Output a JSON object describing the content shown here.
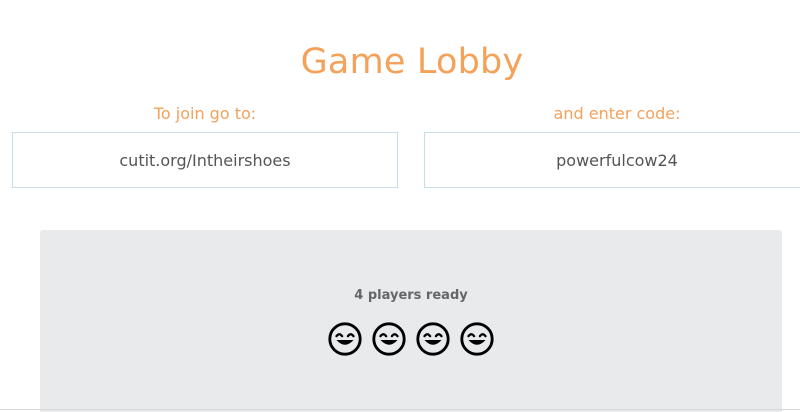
{
  "header": {
    "title": "Game Lobby"
  },
  "join": {
    "label": "To join go to:",
    "url": "cutit.org/Intheirshoes"
  },
  "code": {
    "label": "and enter code:",
    "value": "powerfulcow24"
  },
  "lobby": {
    "status": "4 players ready",
    "player_count": 4,
    "player_icon": "smiling-face-icon"
  },
  "colors": {
    "accent": "#f4a15a",
    "field_border": "#c9dde8",
    "lobby_bg": "#e8eaec",
    "status_text": "#666666"
  }
}
